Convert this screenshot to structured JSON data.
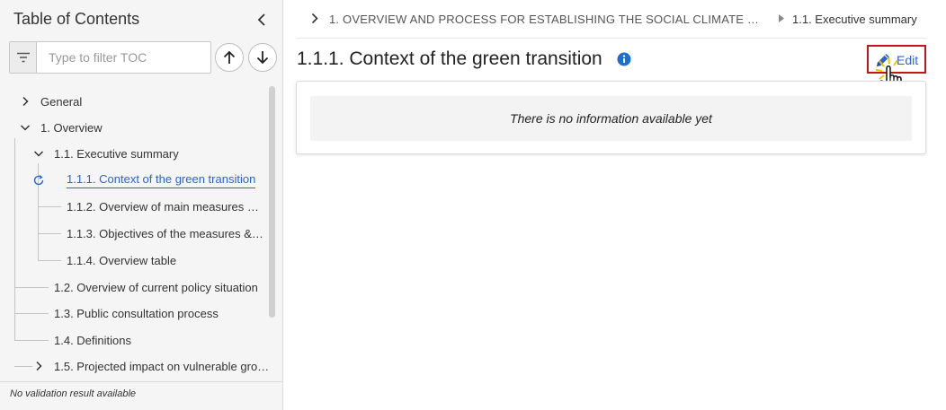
{
  "sidebar": {
    "title": "Table of Contents",
    "filter_placeholder": "Type to filter TOC",
    "footer": "No validation result available",
    "tree": [
      {
        "label": "General"
      },
      {
        "label": "1. Overview"
      },
      {
        "label": "1.1. Executive summary"
      },
      {
        "label": "1.1.1. Context of the green transition"
      },
      {
        "label": "1.1.2. Overview of main measures …"
      },
      {
        "label": "1.1.3. Objectives of the measures &…"
      },
      {
        "label": "1.1.4. Overview table"
      },
      {
        "label": "1.2. Overview of current policy situation"
      },
      {
        "label": "1.3. Public consultation process"
      },
      {
        "label": "1.4. Definitions"
      },
      {
        "label": "1.5. Projected impact on vulnerable gro…"
      }
    ]
  },
  "breadcrumb": {
    "items": [
      "1. OVERVIEW AND PROCESS FOR ESTABLISHING THE SOCIAL CLIMATE …",
      "1.1. Executive summary"
    ]
  },
  "main": {
    "title": "1.1.1. Context of the green transition",
    "edit_label": "Edit",
    "empty_message": "There is no information available yet"
  },
  "colors": {
    "accent": "#2a64d4",
    "highlight_border": "#c0161b",
    "info_icon": "#1a6fd1"
  },
  "icons": [
    "chevron-left-icon",
    "filter-icon",
    "arrow-up-icon",
    "arrow-down-icon",
    "chevron-right-icon",
    "chevron-down-icon",
    "refresh-icon",
    "triangle-right-icon",
    "info-icon",
    "pencil-icon",
    "hand-cursor-icon"
  ]
}
